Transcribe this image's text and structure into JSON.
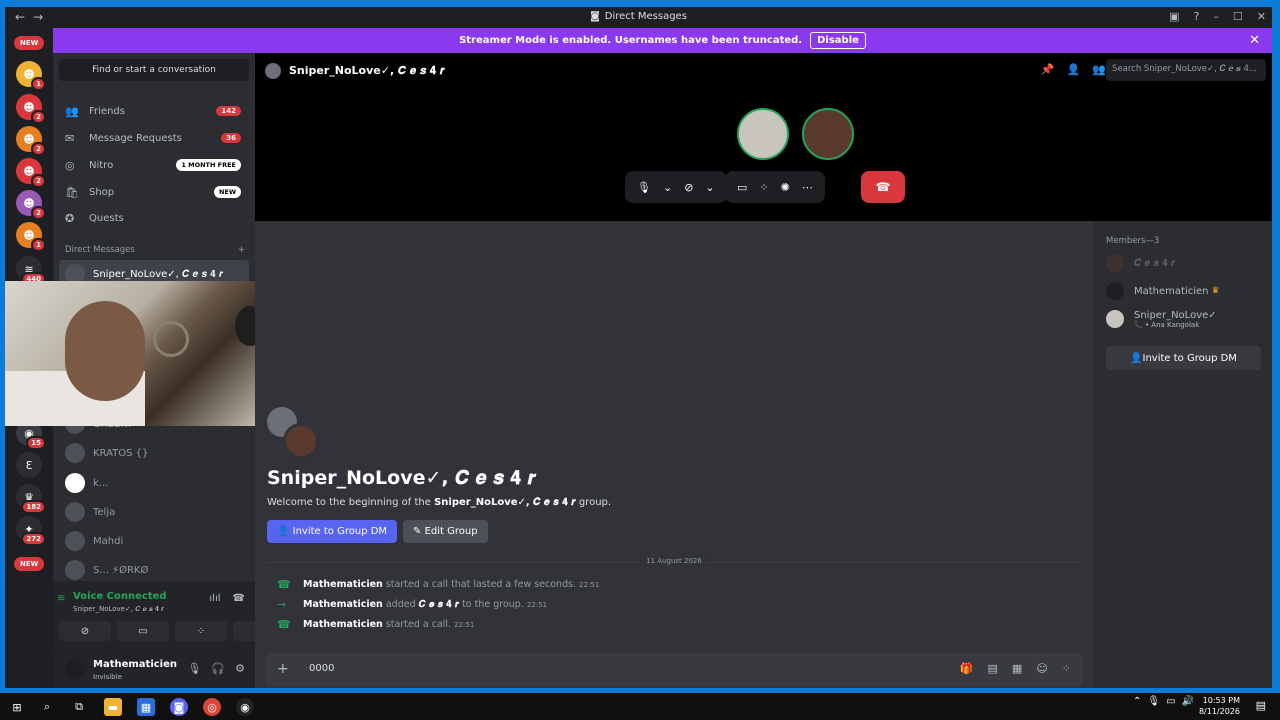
{
  "titlebar": {
    "title": "Direct Messages",
    "back": "←",
    "forward": "→"
  },
  "banner": {
    "text": "Streamer Mode is enabled. Usernames have been truncated.",
    "button": "Disable",
    "close": "✕"
  },
  "rail": {
    "new_top": "NEW",
    "new_bottom": "NEW",
    "badges": [
      "1",
      "2",
      "2",
      "2",
      "2",
      "1",
      "440",
      "15",
      "182",
      "272"
    ]
  },
  "sidebar": {
    "find": "Find or start a conversation",
    "nav": [
      {
        "label": "Friends",
        "count": "142"
      },
      {
        "label": "Message Requests",
        "count": "36"
      },
      {
        "label": "Nitro",
        "pill": "1 MONTH FREE"
      },
      {
        "label": "Shop",
        "pill": "NEW"
      },
      {
        "label": "Quests"
      }
    ],
    "dm_header": "Direct Messages",
    "dm_add": "+",
    "dms": [
      {
        "name": "Sniper_NoLove✓, 𝑪 𝒆 𝒔 𝟒 𝒓"
      },
      {
        "name": "GREEN✗"
      },
      {
        "name": "KRATOS {}"
      },
      {
        "name": "k..."
      },
      {
        "name": "Telja"
      },
      {
        "name": "Mahdi"
      },
      {
        "name": "S...  ⚡ØRKØ"
      }
    ]
  },
  "voice": {
    "title": "Voice Connected",
    "subtitle": "Sniper_NoLove✓, 𝑪 𝒆 𝒔 𝟒 𝒓"
  },
  "user": {
    "name": "Mathematicien",
    "status": "Invisible"
  },
  "call": {
    "title": "Sniper_NoLove✓, 𝑪 𝒆 𝒔 𝟒 𝒓",
    "search_placeholder": "Search Sniper_NoLove✓, 𝑪 𝒆 𝒔 4..."
  },
  "chat": {
    "welcome_title": "Sniper_NoLove✓, 𝑪 𝒆 𝒔 𝟒 𝒓",
    "welcome_pre": "Welcome to the beginning of the ",
    "welcome_name": "Sniper_NoLove✓, 𝑪 𝒆 𝒔 𝟒 𝒓",
    "welcome_post": " group.",
    "invite_button": "Invite to Group DM",
    "edit_button": "Edit Group",
    "date_divider": "11 August 2026",
    "messages": [
      {
        "icon": "phone",
        "author": "Mathematicien",
        "text": "started a call that lasted a few seconds.",
        "time": "22:51"
      },
      {
        "icon": "arrow",
        "author": "Mathematicien",
        "text_pre": "added",
        "target": "𝑪 𝒆 𝒔 𝟒 𝒓",
        "text_post": "to the group.",
        "time": "22:51"
      },
      {
        "icon": "phone",
        "author": "Mathematicien",
        "text": "started a call.",
        "time": "22:51"
      }
    ],
    "composer_value": "0000"
  },
  "members": {
    "header": "Members—3",
    "list": [
      {
        "name": "𝑪 𝒆 𝒔 𝟒 𝒓",
        "sub": ""
      },
      {
        "name": "Mathematicien",
        "sub": ""
      },
      {
        "name": "Sniper_NoLove✓",
        "sub": "📞 • Ana Kangolak"
      }
    ],
    "invite_button": "Invite to Group DM"
  },
  "taskbar": {
    "time": "10:53 PM",
    "date": "8/11/2026"
  }
}
